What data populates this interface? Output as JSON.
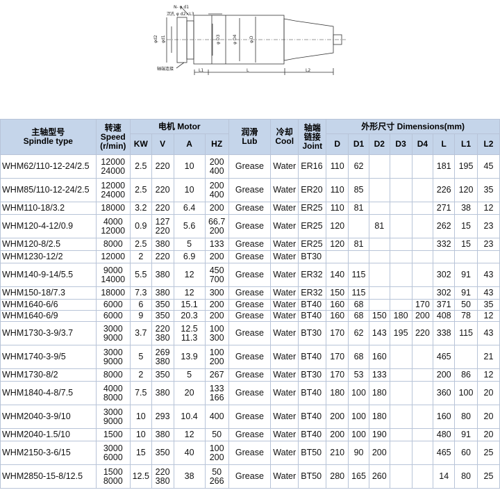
{
  "drawing": {
    "labels": {
      "n_d1": "N- φ d1",
      "counterbore": "沉孔 φ d2×L3",
      "phi_d2": "φd2",
      "phi_d1": "φd1",
      "phi_d3": "φ D3",
      "phi_d4": "φ D4",
      "phi_d": "φ D",
      "shaft_end": "轴端连接",
      "l1": "L1",
      "l": "L",
      "l2": "L2"
    }
  },
  "table": {
    "headers": {
      "model": [
        "主轴型号",
        "Spindle type"
      ],
      "speed": [
        "转速",
        "Speed",
        "(r/min)"
      ],
      "motor": "电机 Motor",
      "kw": "KW",
      "v": "V",
      "a": "A",
      "hz": "HZ",
      "lub": [
        "润滑",
        "Lub"
      ],
      "cool": [
        "冷却",
        "Cool"
      ],
      "joint": [
        "轴端",
        "链接",
        "Joint"
      ],
      "dimensions": "外形尺寸 Dimensions(mm)",
      "dim_cols": [
        "D",
        "D1",
        "D2",
        "D3",
        "D4",
        "L",
        "L1",
        "L2"
      ]
    },
    "rows": [
      {
        "model": "WHM62/110-12-24/2.5",
        "speed": [
          "12000",
          "24000"
        ],
        "kw": "2.5",
        "v": [
          "220"
        ],
        "a": [
          "10"
        ],
        "hz": [
          "200",
          "400"
        ],
        "lub": "Grease",
        "cool": "Water",
        "joint": "ER16",
        "dims": [
          "110",
          "62",
          "",
          "",
          "",
          "181",
          "195",
          "45"
        ]
      },
      {
        "model": "WHM85/110-12-24/2.5",
        "speed": [
          "12000",
          "24000"
        ],
        "kw": "2.5",
        "v": [
          "220"
        ],
        "a": [
          "10"
        ],
        "hz": [
          "200",
          "400"
        ],
        "lub": "Grease",
        "cool": "Water",
        "joint": "ER20",
        "dims": [
          "110",
          "85",
          "",
          "",
          "",
          "226",
          "120",
          "35"
        ]
      },
      {
        "model": "WHM110-18/3.2",
        "speed": [
          "18000"
        ],
        "kw": "3.2",
        "v": [
          "220"
        ],
        "a": [
          "6.4"
        ],
        "hz": [
          "200"
        ],
        "lub": "Grease",
        "cool": "Water",
        "joint": "ER25",
        "dims": [
          "110",
          "81",
          "",
          "",
          "",
          "271",
          "38",
          "12"
        ]
      },
      {
        "model": "WHM120-4-12/0.9",
        "speed": [
          "4000",
          "12000"
        ],
        "kw": "0.9",
        "v": [
          "127",
          "220"
        ],
        "a": [
          "5.6"
        ],
        "hz": [
          "66.7",
          "200"
        ],
        "lub": "Grease",
        "cool": "Water",
        "joint": "ER25",
        "dims": [
          "120",
          "",
          "81",
          "",
          "",
          "262",
          "15",
          "23"
        ]
      },
      {
        "model": "WHM120-8/2.5",
        "speed": [
          "8000"
        ],
        "kw": "2.5",
        "v": [
          "380"
        ],
        "a": [
          "5"
        ],
        "hz": [
          "133"
        ],
        "lub": "Grease",
        "cool": "Water",
        "joint": "ER25",
        "dims": [
          "120",
          "81",
          "",
          "",
          "",
          "332",
          "15",
          "23"
        ]
      },
      {
        "model": "WHM1230-12/2",
        "speed": [
          "12000"
        ],
        "kw": "2",
        "v": [
          "220"
        ],
        "a": [
          "6.9"
        ],
        "hz": [
          "200"
        ],
        "lub": "Grease",
        "cool": "Water",
        "joint": "BT30",
        "dims": [
          "",
          "",
          "",
          "",
          "",
          "",
          "",
          ""
        ]
      },
      {
        "model": "WHM140-9-14/5.5",
        "speed": [
          "9000",
          "14000"
        ],
        "kw": "5.5",
        "v": [
          "380"
        ],
        "a": [
          "12"
        ],
        "hz": [
          "450",
          "700"
        ],
        "lub": "Grease",
        "cool": "Water",
        "joint": "ER32",
        "dims": [
          "140",
          "115",
          "",
          "",
          "",
          "302",
          "91",
          "43"
        ]
      },
      {
        "model": "WHM150-18/7.3",
        "speed": [
          "18000"
        ],
        "kw": "7.3",
        "v": [
          "380"
        ],
        "a": [
          "12"
        ],
        "hz": [
          "300"
        ],
        "lub": "Grease",
        "cool": "Water",
        "joint": "ER32",
        "dims": [
          "150",
          "115",
          "",
          "",
          "",
          "302",
          "91",
          "43"
        ]
      },
      {
        "model": "WHM1640-6/6",
        "speed": [
          "6000"
        ],
        "kw": "6",
        "v": [
          "350"
        ],
        "a": [
          "15.1"
        ],
        "hz": [
          "200"
        ],
        "lub": "Grease",
        "cool": "Water",
        "joint": "BT40",
        "dims": [
          "160",
          "68",
          "",
          "",
          "170",
          "371",
          "50",
          "35"
        ]
      },
      {
        "model": "WHM1640-6/9",
        "speed": [
          "6000"
        ],
        "kw": "9",
        "v": [
          "350"
        ],
        "a": [
          "20.3"
        ],
        "hz": [
          "200"
        ],
        "lub": "Grease",
        "cool": "Water",
        "joint": "BT40",
        "dims": [
          "160",
          "68",
          "150",
          "180",
          "200",
          "408",
          "78",
          "12"
        ]
      },
      {
        "model": "WHM1730-3-9/3.7",
        "speed": [
          "3000",
          "9000"
        ],
        "kw": "3.7",
        "v": [
          "220",
          "380"
        ],
        "a": [
          "12.5",
          "11.3"
        ],
        "hz": [
          "100",
          "300"
        ],
        "lub": "Grease",
        "cool": "Water",
        "joint": "BT30",
        "dims": [
          "170",
          "62",
          "143",
          "195",
          "220",
          "338",
          "115",
          "43"
        ]
      },
      {
        "model": "WHM1740-3-9/5",
        "speed": [
          "3000",
          "9000"
        ],
        "kw": "5",
        "v": [
          "269",
          "380"
        ],
        "a": [
          "13.9"
        ],
        "hz": [
          "100",
          "200"
        ],
        "lub": "Grease",
        "cool": "Water",
        "joint": "BT40",
        "dims": [
          "170",
          "68",
          "160",
          "",
          "",
          "465",
          "",
          "21"
        ]
      },
      {
        "model": "WHM1730-8/2",
        "speed": [
          "8000"
        ],
        "kw": "2",
        "v": [
          "350"
        ],
        "a": [
          "5"
        ],
        "hz": [
          "267"
        ],
        "lub": "Grease",
        "cool": "Water",
        "joint": "BT30",
        "dims": [
          "170",
          "53",
          "133",
          "",
          "",
          "200",
          "86",
          "12"
        ]
      },
      {
        "model": "WHM1840-4-8/7.5",
        "speed": [
          "4000",
          "8000"
        ],
        "kw": "7.5",
        "v": [
          "380"
        ],
        "a": [
          "20"
        ],
        "hz": [
          "133",
          "166"
        ],
        "lub": "Grease",
        "cool": "Water",
        "joint": "BT40",
        "dims": [
          "180",
          "100",
          "180",
          "",
          "",
          "360",
          "100",
          "20"
        ]
      },
      {
        "model": "WHM2040-3-9/10",
        "speed": [
          "3000",
          "9000"
        ],
        "kw": "10",
        "v": [
          "293"
        ],
        "a": [
          "10.4"
        ],
        "hz": [
          "400"
        ],
        "lub": "Grease",
        "cool": "Water",
        "joint": "BT40",
        "dims": [
          "200",
          "100",
          "180",
          "",
          "",
          "160",
          "80",
          "20"
        ]
      },
      {
        "model": "WHM2040-1.5/10",
        "speed": [
          "1500"
        ],
        "kw": "10",
        "v": [
          "380"
        ],
        "a": [
          "12"
        ],
        "hz": [
          "50"
        ],
        "lub": "Grease",
        "cool": "Water",
        "joint": "BT40",
        "dims": [
          "200",
          "100",
          "190",
          "",
          "",
          "480",
          "91",
          "20"
        ]
      },
      {
        "model": "WHM2150-3-6/15",
        "speed": [
          "3000",
          "6000"
        ],
        "kw": "15",
        "v": [
          "350"
        ],
        "a": [
          "40"
        ],
        "hz": [
          "100",
          "200"
        ],
        "lub": "Grease",
        "cool": "Water",
        "joint": "BT50",
        "dims": [
          "210",
          "90",
          "200",
          "",
          "",
          "465",
          "60",
          "25"
        ]
      },
      {
        "model": "WHM2850-15-8/12.5",
        "speed": [
          "1500",
          "8000"
        ],
        "kw": "12.5",
        "v": [
          "220",
          "380"
        ],
        "a": [
          "38"
        ],
        "hz": [
          "50",
          "266"
        ],
        "lub": "Grease",
        "cool": "Water",
        "joint": "BT50",
        "dims": [
          "280",
          "165",
          "260",
          "",
          "",
          "14",
          "80",
          "25"
        ]
      }
    ]
  }
}
